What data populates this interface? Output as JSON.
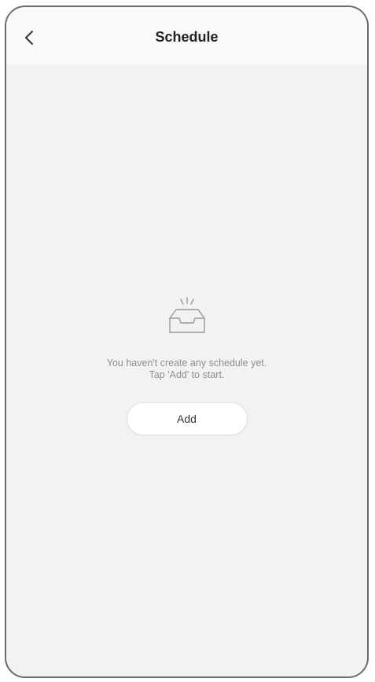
{
  "header": {
    "title": "Schedule",
    "back_icon": "chevron-left-icon"
  },
  "empty_state": {
    "icon": "empty-inbox-icon",
    "message_line1": "You haven't create any schedule yet.",
    "message_line2": "Tap 'Add' to start.",
    "add_label": "Add"
  },
  "colors": {
    "background": "#f2f2f2",
    "header_background": "#fafafa",
    "muted_text": "#8e8e8e"
  }
}
